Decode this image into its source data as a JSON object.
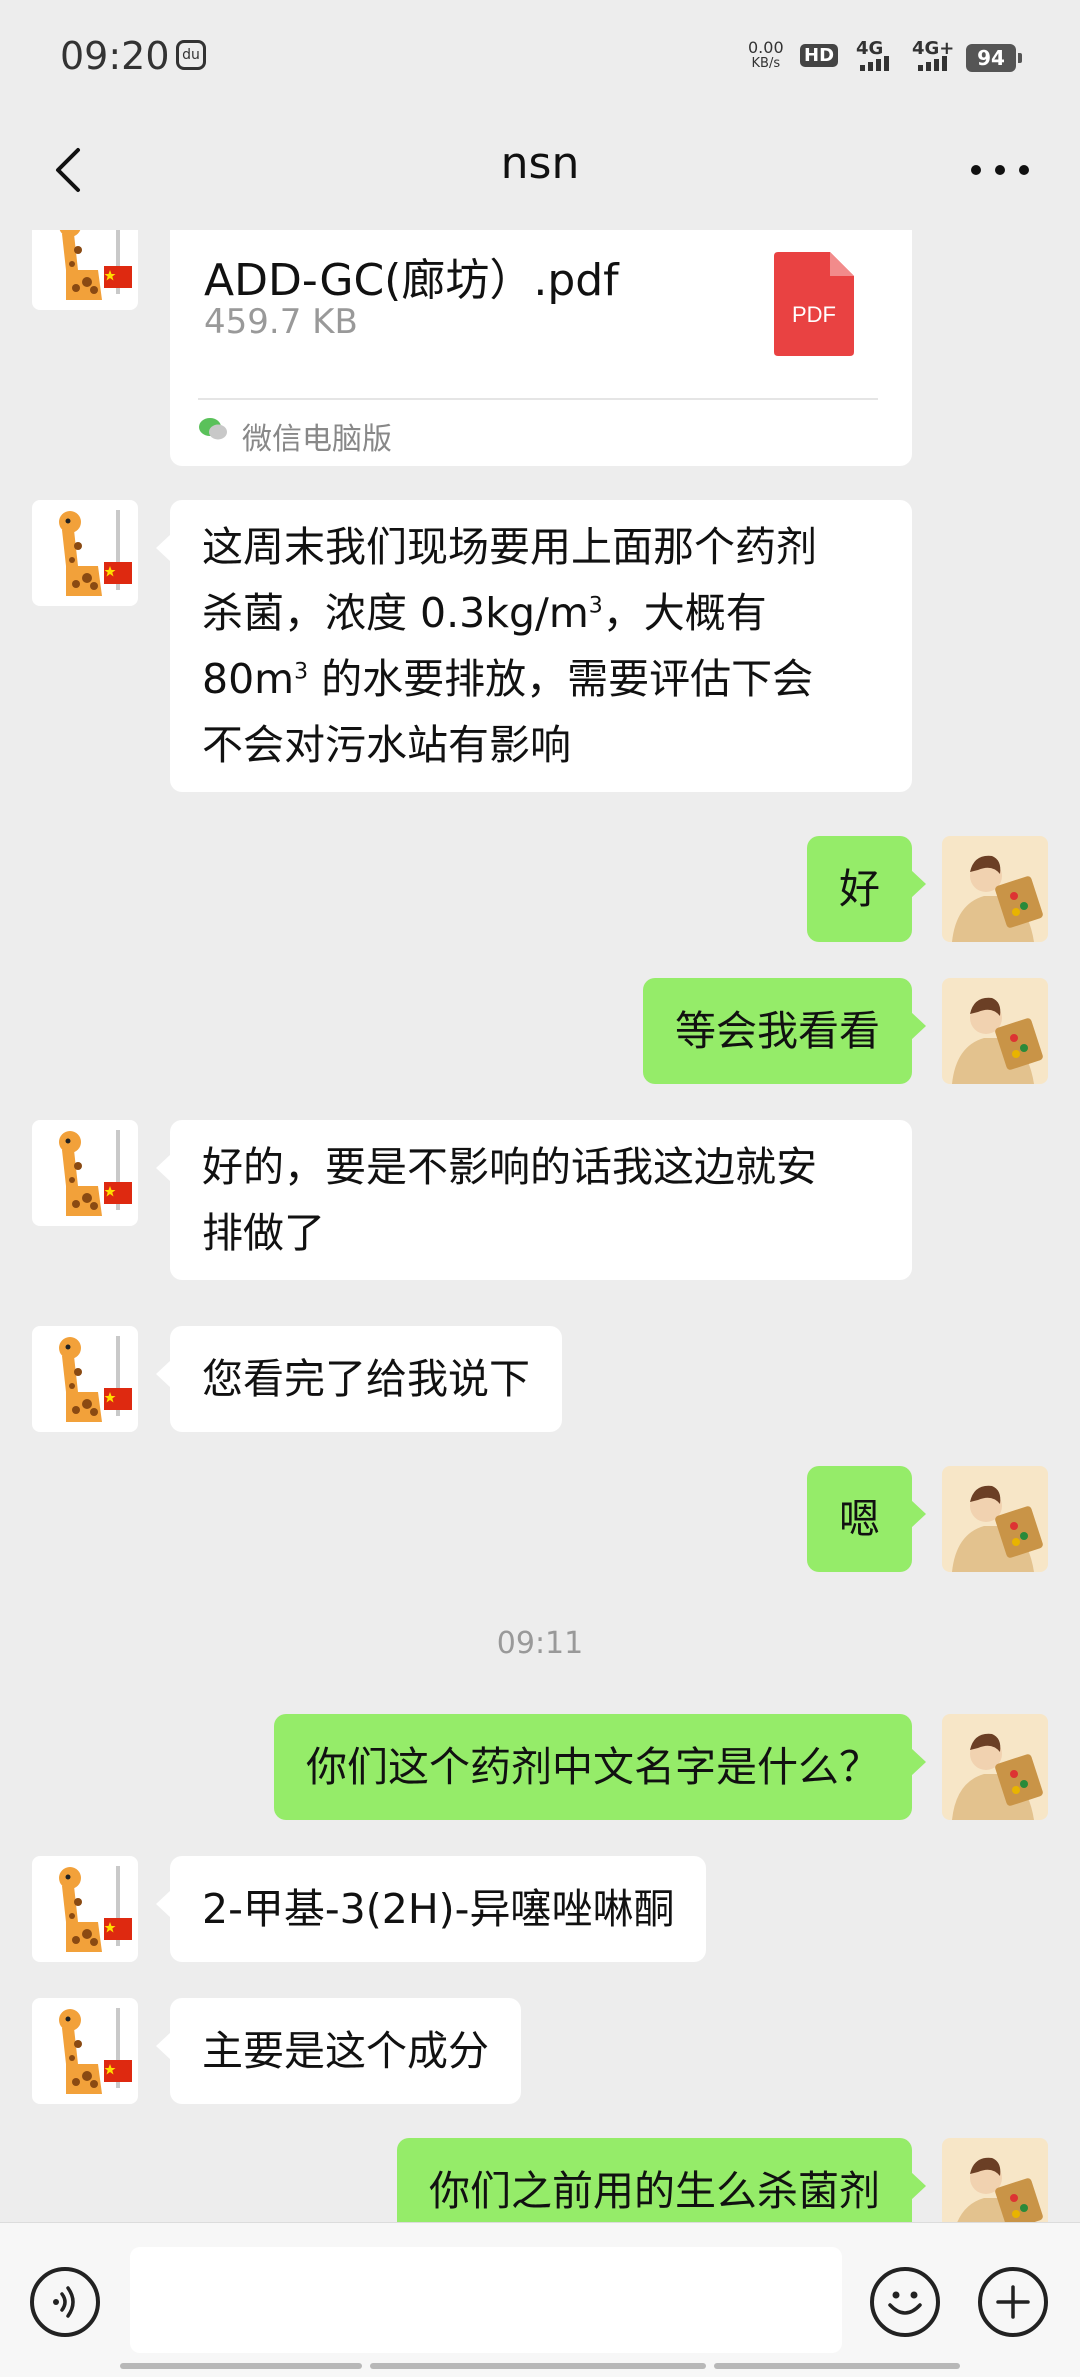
{
  "status_bar": {
    "time": "09:20",
    "dnd_icon_text": "du",
    "net_speed_value": "0.00",
    "net_speed_unit": "KB/s",
    "hd_label": "HD",
    "sim1_label": "4G",
    "sim2_label": "4G+",
    "battery_level": "94"
  },
  "header": {
    "title": "nsn"
  },
  "file_message": {
    "file_name": "ADD-GC(廊坊）.pdf",
    "file_size": "459.7 KB",
    "file_type_label": "PDF",
    "source_label": "微信电脑版"
  },
  "messages": [
    {
      "side": "left",
      "lines": [
        "这周末我们现场要用上面那个药剂",
        "杀菌，浓度 0.3kg/m<sup>3</sup>，大概有",
        "80m<sup>3</sup> 的水要排放，需要评估下会",
        "不会对污水站有影响"
      ]
    },
    {
      "side": "right",
      "text": "好"
    },
    {
      "side": "right",
      "text": "等会我看看"
    },
    {
      "side": "left",
      "lines": [
        "好的，要是不影响的话我这边就安",
        "排做了"
      ]
    },
    {
      "side": "left",
      "text": "您看完了给我说下"
    },
    {
      "side": "right",
      "text": "嗯"
    },
    {
      "side": "right",
      "text": "你们这个药剂中文名字是什么？"
    },
    {
      "side": "left",
      "text": "2-甲基-3(2H)-异噻唑啉酮"
    },
    {
      "side": "left",
      "text": "主要是这个成分"
    },
    {
      "side": "right",
      "text": "你们之前用的生么杀菌剂"
    }
  ],
  "timestamp": "09:11",
  "input_bar": {
    "placeholder": ""
  },
  "colors": {
    "background": "#ededed",
    "bubble_self": "#95ec69",
    "bubble_other": "#ffffff",
    "pdf_red": "#e94242"
  },
  "icons": {
    "back": "chevron-left-icon",
    "more": "more-dots-icon",
    "voice": "voice-icon",
    "emoji": "emoji-icon",
    "plus": "plus-icon",
    "pdf": "pdf-file-icon"
  }
}
